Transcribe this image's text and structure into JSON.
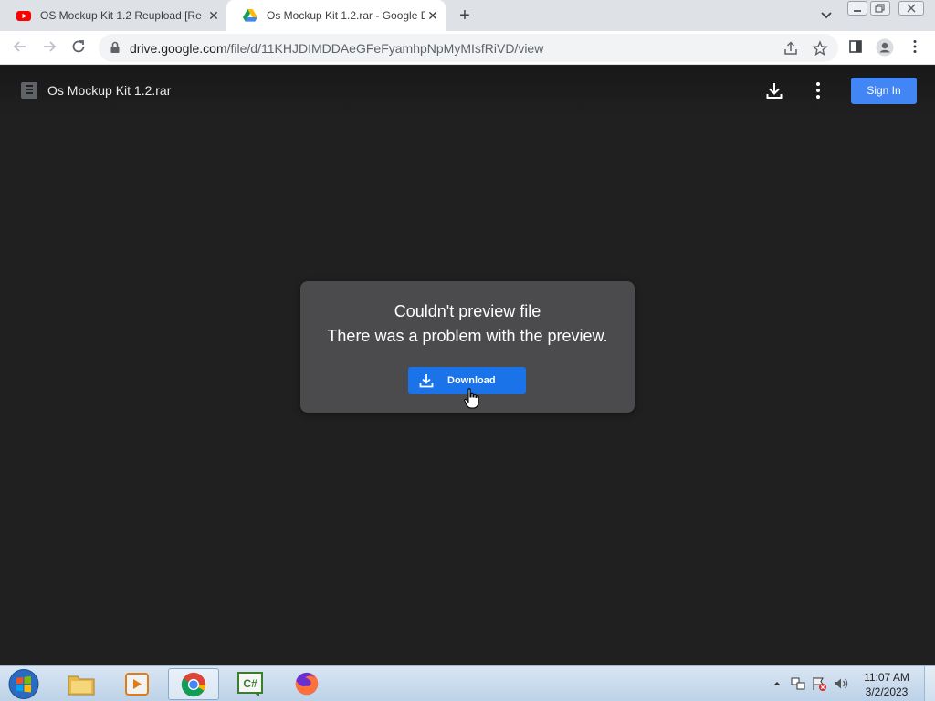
{
  "browser": {
    "tabs": [
      {
        "title": "OS Mockup Kit 1.2 Reupload [Re",
        "favicon": "youtube-icon",
        "active": false
      },
      {
        "title": "Os Mockup Kit 1.2.rar - Google D",
        "favicon": "google-drive-icon",
        "active": true
      }
    ],
    "new_tab_label": "+",
    "url_host": "drive.google.com",
    "url_path": "/file/d/11KHJDIMDDAeGFeFyamhpNpMyMIsfRiVD/view"
  },
  "drive": {
    "file_name": "Os Mockup Kit 1.2.rar",
    "sign_in_label": "Sign In",
    "preview_error": {
      "title": "Couldn't preview file",
      "message": "There was a problem with the preview.",
      "download_label": "Download"
    }
  },
  "taskbar": {
    "apps": [
      "file-explorer-icon",
      "media-player-icon",
      "chrome-icon",
      "csharp-editor-icon",
      "firefox-icon"
    ],
    "active_app": "chrome-icon",
    "time": "11:07 AM",
    "date": "3/2/2023"
  },
  "colors": {
    "accent": "#1a73e8",
    "sign_in": "#4285f4",
    "viewer_background": "#202020",
    "dialog_background": "#4b4b4d"
  }
}
